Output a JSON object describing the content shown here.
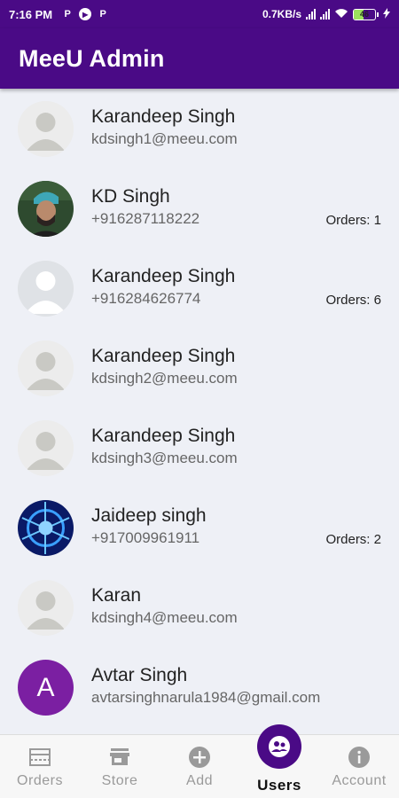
{
  "status_bar": {
    "time": "7:16 PM",
    "speed": "0.7KB/s",
    "battery": "46",
    "icons": [
      "p-icon",
      "play-icon",
      "p-icon",
      "signal-icon",
      "signal-icon",
      "wifi-icon",
      "battery-icon",
      "charging-icon"
    ]
  },
  "app_bar": {
    "title": "MeeU Admin"
  },
  "users": [
    {
      "name": "Karandeep Singh",
      "contact": "kdsingh1@meeu.com",
      "orders": "",
      "avatar": "placeholder"
    },
    {
      "name": "KD Singh",
      "contact": "+916287118222",
      "orders": "Orders: 1",
      "avatar": "photo"
    },
    {
      "name": "Karandeep Singh",
      "contact": "+916284626774",
      "orders": "Orders: 6",
      "avatar": "placeholder-light"
    },
    {
      "name": "Karandeep Singh",
      "contact": "kdsingh2@meeu.com",
      "orders": "",
      "avatar": "placeholder"
    },
    {
      "name": "Karandeep Singh",
      "contact": "kdsingh3@meeu.com",
      "orders": "",
      "avatar": "placeholder"
    },
    {
      "name": "Jaideep singh",
      "contact": "+917009961911",
      "orders": "Orders: 2",
      "avatar": "abstract-blue"
    },
    {
      "name": "Karan",
      "contact": "kdsingh4@meeu.com",
      "orders": "",
      "avatar": "placeholder"
    },
    {
      "name": "Avtar Singh",
      "contact": "avtarsinghnarula1984@gmail.com",
      "orders": "",
      "avatar": "letter",
      "letter": "A"
    }
  ],
  "bottom_nav": {
    "items": [
      {
        "label": "Orders",
        "icon": "orders-icon",
        "active": false
      },
      {
        "label": "Store",
        "icon": "store-icon",
        "active": false
      },
      {
        "label": "Add",
        "icon": "add-icon",
        "active": false
      },
      {
        "label": "Users",
        "icon": "users-icon",
        "active": true
      },
      {
        "label": "Account",
        "icon": "info-icon",
        "active": false
      }
    ]
  },
  "colors": {
    "primary": "#4a0a86",
    "avatar_letter_bg": "#7b1fa2",
    "inactive": "#9a9a9a"
  }
}
